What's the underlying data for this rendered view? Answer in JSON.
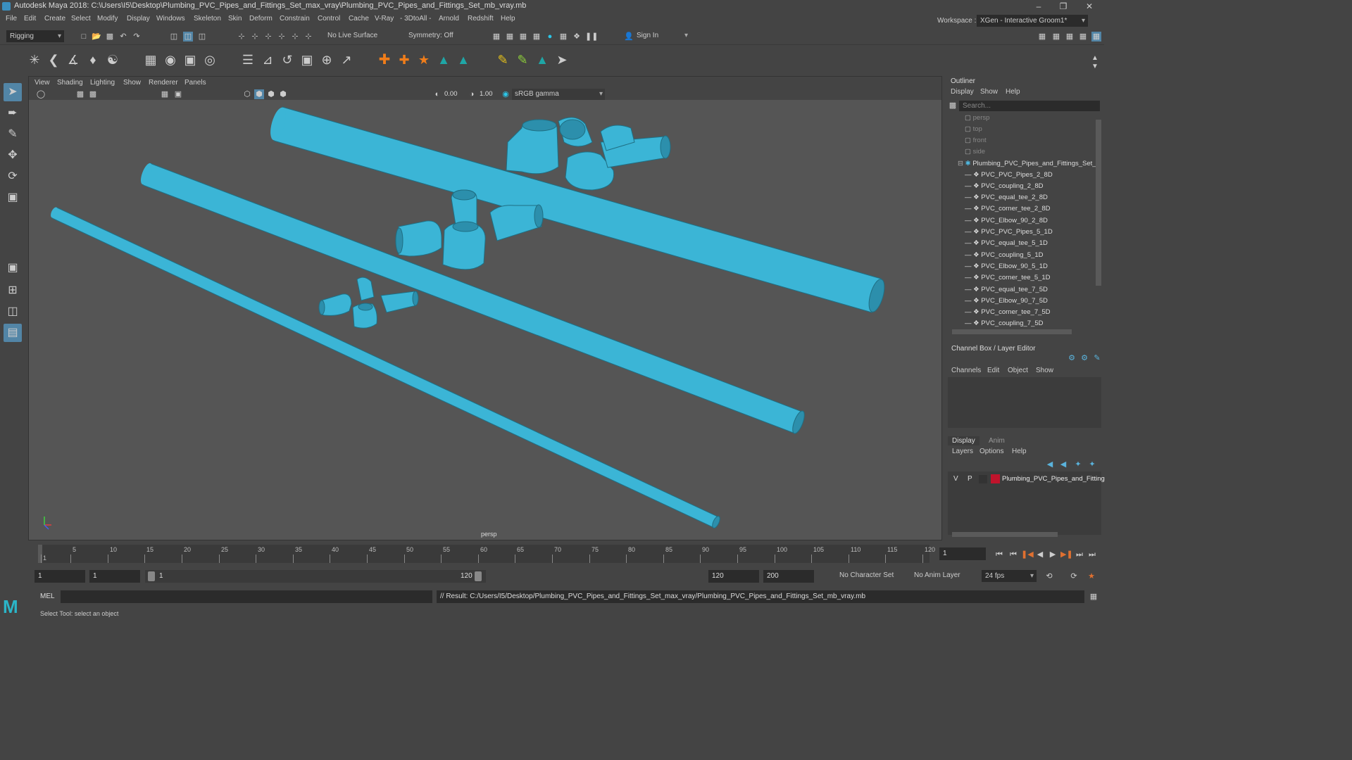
{
  "title": "Autodesk Maya 2018: C:\\Users\\I5\\Desktop\\Plumbing_PVC_Pipes_and_Fittings_Set_max_vray\\Plumbing_PVC_Pipes_and_Fittings_Set_mb_vray.mb",
  "menus": [
    "File",
    "Edit",
    "Create",
    "Select",
    "Modify",
    "Display",
    "Windows",
    "Skeleton",
    "Skin",
    "Deform",
    "Constrain",
    "Control",
    "Cache",
    "V-Ray",
    "- 3DtoAll -",
    "Arnold",
    "Redshift",
    "Help"
  ],
  "workspace_label": "Workspace :",
  "workspace_value": "XGen - Interactive Groom1*",
  "mode_menu": "Rigging",
  "live_surface": "No Live Surface",
  "symmetry": "Symmetry: Off",
  "sign_in": "Sign In",
  "vp_menus": [
    "View",
    "Shading",
    "Lighting",
    "Show",
    "Renderer",
    "Panels"
  ],
  "vp_exposure": "0.00",
  "vp_gamma": "1.00",
  "vp_colorspace": "sRGB gamma",
  "camera_label": "persp",
  "outliner": {
    "title": "Outliner",
    "menus": [
      "Display",
      "Show",
      "Help"
    ],
    "search_placeholder": "Search...",
    "cameras": [
      "persp",
      "top",
      "front",
      "side"
    ],
    "group": "Plumbing_PVC_Pipes_and_Fittings_Set_r",
    "items": [
      "PVC_PVC_Pipes_2_8D",
      "PVC_coupling_2_8D",
      "PVC_equal_tee_2_8D",
      "PVC_corner_tee_2_8D",
      "PVC_Elbow_90_2_8D",
      "PVC_PVC_Pipes_5_1D",
      "PVC_equal_tee_5_1D",
      "PVC_coupling_5_1D",
      "PVC_Elbow_90_5_1D",
      "PVC_corner_tee_5_1D",
      "PVC_equal_tee_7_5D",
      "PVC_Elbow_90_7_5D",
      "PVC_corner_tee_7_5D",
      "PVC_coupling_7_5D"
    ]
  },
  "channel_box": {
    "title": "Channel Box / Layer Editor",
    "menus": [
      "Channels",
      "Edit",
      "Object",
      "Show"
    ]
  },
  "layer_editor": {
    "tabs": [
      "Display",
      "Anim"
    ],
    "menus": [
      "Layers",
      "Options",
      "Help"
    ],
    "layer_v": "V",
    "layer_p": "P",
    "layer_name": "Plumbing_PVC_Pipes_and_Fitting",
    "layer_color": "#c0142c"
  },
  "timeline": {
    "ticks": [
      "1",
      "5",
      "10",
      "15",
      "20",
      "25",
      "30",
      "35",
      "40",
      "45",
      "50",
      "55",
      "60",
      "65",
      "70",
      "75",
      "80",
      "85",
      "90",
      "95",
      "100",
      "105",
      "110",
      "115",
      "120"
    ],
    "current_frame": "1"
  },
  "range": {
    "start": "1",
    "anim_start": "1",
    "slider_start": "1",
    "slider_end": "120",
    "end": "120",
    "anim_end": "200",
    "character_set": "No Character Set",
    "anim_layer": "No Anim Layer",
    "fps": "24 fps"
  },
  "cmd": {
    "label": "MEL",
    "result": "// Result: C:/Users/I5/Desktop/Plumbing_PVC_Pipes_and_Fittings_Set_max_vray/Plumbing_PVC_Pipes_and_Fittings_Set_mb_vray.mb"
  },
  "help_line": "Select Tool: select an object",
  "colors": {
    "pipe": "#3ab4d4",
    "pipe_dark": "#2a8aa6",
    "bg": "#555555",
    "panel": "#444444"
  }
}
